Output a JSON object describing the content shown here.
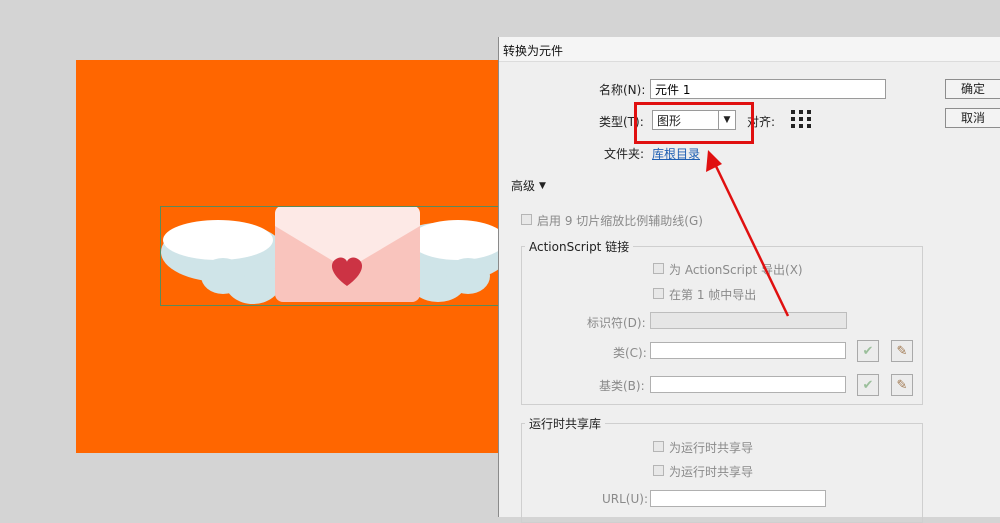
{
  "dialog": {
    "title": "转换为元件",
    "name_label": "名称(N):",
    "name_value": "元件 1",
    "type_label": "类型(T):",
    "type_value": "图形",
    "align_label": "对齐:",
    "folder_label": "文件夹:",
    "folder_link": "库根目录",
    "ok_label": "确定",
    "cancel_label": "取消",
    "advanced_label": "高级",
    "enable_9slice_label": "启用 9 切片缩放比例辅助线(G)",
    "actionscript": {
      "group_title": "ActionScript 链接",
      "export_as_label": "为 ActionScript 导出(X)",
      "export_frame1_label": "在第 1 帧中导出",
      "identifier_label": "标识符(D):",
      "class_label": "类(C):",
      "base_class_label": "基类(B):"
    },
    "runtime": {
      "group_title": "运行时共享库",
      "export_share_label": "为运行时共享导",
      "import_share_label": "为运行时共享导",
      "url_label": "URL(U):"
    }
  },
  "colors": {
    "stage": "#ff6600",
    "annotation": "#e01010",
    "envelope": "#f9c4bd",
    "heart": "#cc3344"
  }
}
